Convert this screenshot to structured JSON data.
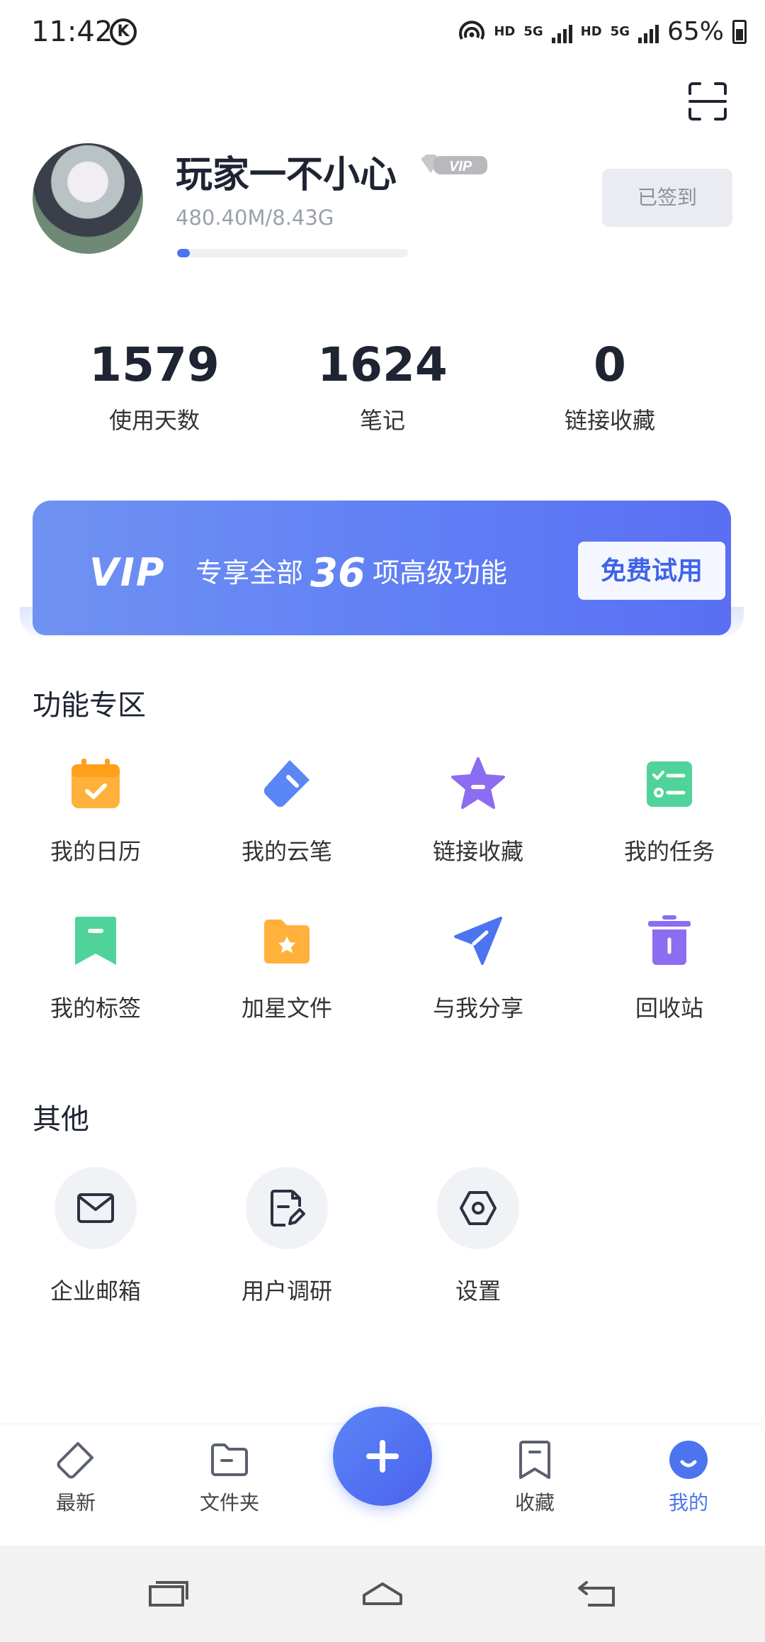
{
  "status_bar": {
    "time": "11:42",
    "k_badge": "K",
    "hd1": "HD",
    "net1": "5G",
    "hd2": "HD",
    "net2": "5G",
    "battery": "65%"
  },
  "profile": {
    "username": "玩家一不小心",
    "vip_badge": "VIP",
    "storage": "480.40M/8.43G",
    "storage_used_fraction": 0.056,
    "signed_button": "已签到"
  },
  "stats": [
    {
      "value": "1579",
      "label": "使用天数"
    },
    {
      "value": "1624",
      "label": "笔记"
    },
    {
      "value": "0",
      "label": "链接收藏"
    }
  ],
  "vip_banner": {
    "logo": "VIP",
    "text_prefix": "专享全部",
    "count": "36",
    "text_suffix": "项高级功能",
    "button": "免费试用"
  },
  "features": {
    "title": "功能专区",
    "items": [
      {
        "label": "我的日历",
        "icon": "calendar-icon",
        "color": "#ffb13b"
      },
      {
        "label": "我的云笔",
        "icon": "pen-tag-icon",
        "color": "#5b86f6"
      },
      {
        "label": "链接收藏",
        "icon": "star-icon",
        "color": "#8c6cf0"
      },
      {
        "label": "我的任务",
        "icon": "tasklist-icon",
        "color": "#4fd39a"
      },
      {
        "label": "我的标签",
        "icon": "bookmark-icon",
        "color": "#4fd39a"
      },
      {
        "label": "加星文件",
        "icon": "star-folder-icon",
        "color": "#ffb13b"
      },
      {
        "label": "与我分享",
        "icon": "send-icon",
        "color": "#4c74f0"
      },
      {
        "label": "回收站",
        "icon": "trash-icon",
        "color": "#8c6cf0"
      }
    ]
  },
  "others": {
    "title": "其他",
    "items": [
      {
        "label": "企业邮箱",
        "icon": "mail-icon"
      },
      {
        "label": "用户调研",
        "icon": "survey-icon"
      },
      {
        "label": "设置",
        "icon": "settings-icon"
      }
    ]
  },
  "tab_bar": {
    "items": [
      {
        "label": "最新",
        "icon": "latest-icon"
      },
      {
        "label": "文件夹",
        "icon": "folder-icon"
      },
      {
        "label": "收藏",
        "icon": "favorites-icon"
      },
      {
        "label": "我的",
        "icon": "profile-icon",
        "active": true
      }
    ],
    "fab_icon": "plus-icon"
  },
  "colors": {
    "accent": "#4c74f0",
    "text": "#1f2433"
  }
}
